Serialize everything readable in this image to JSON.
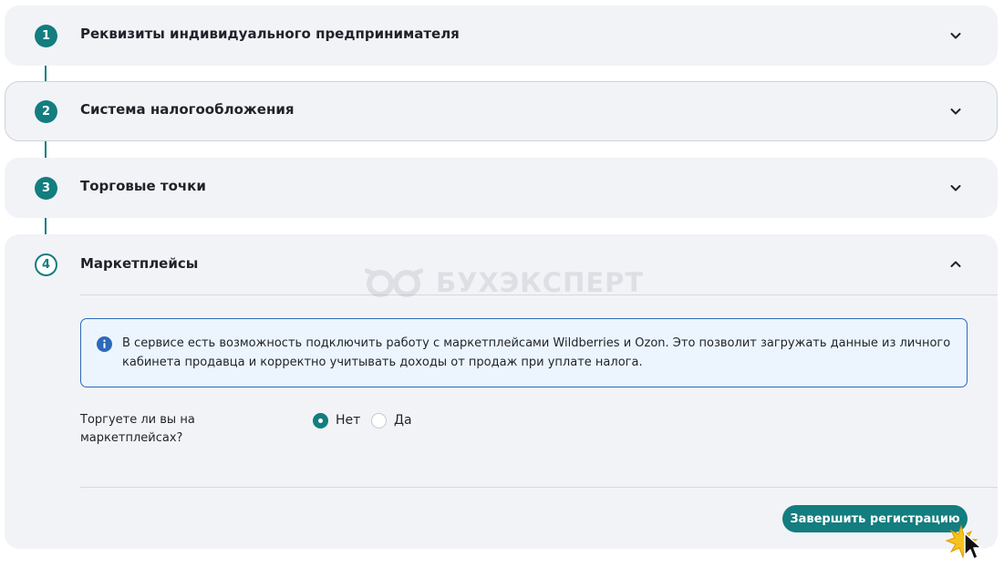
{
  "steps": [
    {
      "number": "1",
      "title": "Реквизиты индивидуального предпринимателя"
    },
    {
      "number": "2",
      "title": "Система налогообложения"
    },
    {
      "number": "3",
      "title": "Торговые точки"
    },
    {
      "number": "4",
      "title": "Маркетплейсы"
    }
  ],
  "marketplaces": {
    "info_text": "В сервисе есть возможность подключить работу с маркетплейсами Wildberries и Ozon. Это позволит загружать данные из личного кабинета продавца и корректно учитывать доходы от продаж при уплате налога.",
    "question": "Торгуете ли вы на маркетплейсах?",
    "options": [
      {
        "label": "Нет",
        "selected": true
      },
      {
        "label": "Да",
        "selected": false
      }
    ],
    "finish_label": "Завершить регистрацию"
  },
  "watermark": "БУХЭКСПЕРТ",
  "colors": {
    "accent": "#137d7f",
    "panel": "#f2f3f7",
    "info_border": "#2e69b9",
    "info_bg": "#ecf5fd"
  },
  "icons": {
    "collapsed_step": "chevron-down-icon",
    "expanded_step": "chevron-up-icon",
    "info": "info-icon",
    "cursor": "mouse-pointer-icon"
  }
}
